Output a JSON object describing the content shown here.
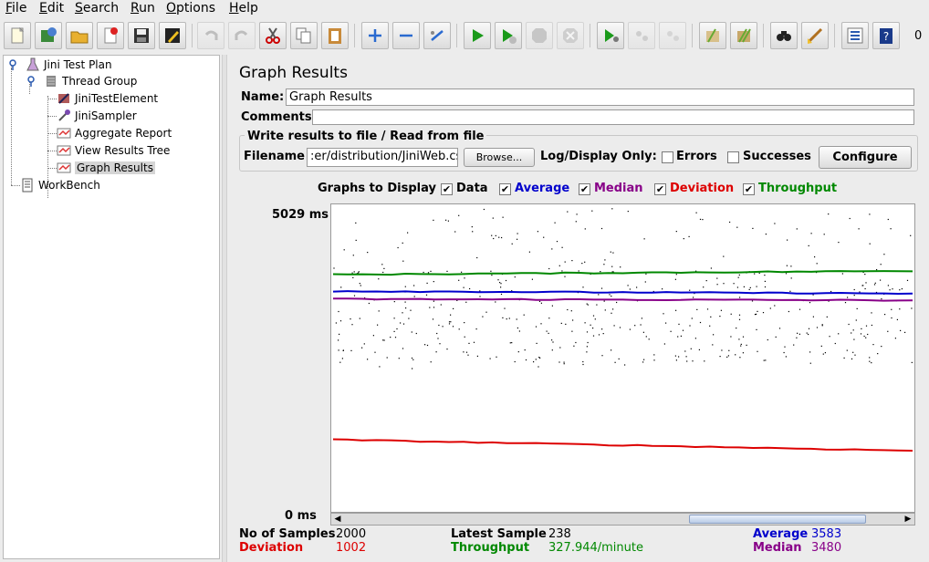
{
  "menu": {
    "items": [
      {
        "key": "F",
        "rest": "ile"
      },
      {
        "key": "E",
        "rest": "dit"
      },
      {
        "key": "S",
        "rest": "earch"
      },
      {
        "key": "R",
        "rest": "un"
      },
      {
        "key": "O",
        "rest": "ptions"
      },
      {
        "key": "H",
        "rest": "elp"
      }
    ]
  },
  "toolbar": {
    "count": "0"
  },
  "tree": {
    "test_plan": "Jini Test Plan",
    "thread_group": "Thread Group",
    "jini_test_element": "JiniTestElement",
    "jini_sampler": "JiniSampler",
    "aggregate_report": "Aggregate Report",
    "view_results_tree": "View Results Tree",
    "graph_results": "Graph Results",
    "workbench": "WorkBench"
  },
  "panel": {
    "title": "Graph Results",
    "name_label": "Name:",
    "name_value": "Graph Results",
    "comments_label": "Comments:",
    "comments_value": "",
    "write_group_title": "Write results to file / Read from file",
    "filename_label": "Filename",
    "filename_value": ":er/distribution/JiniWeb.csv",
    "browse_button": "Browse...",
    "log_display_label": "Log/Display Only:",
    "errors_label": "Errors",
    "successes_label": "Successes",
    "configure_button": "Configure",
    "graphs_to_display": "Graphs to Display",
    "graph_options": {
      "data": "Data",
      "average": "Average",
      "median": "Median",
      "deviation": "Deviation",
      "throughput": "Throughput"
    },
    "y_max_label": "5029 ms",
    "y_min_label": "0 ms"
  },
  "colors": {
    "average": "#0000cc",
    "median": "#880088",
    "deviation": "#dd0000",
    "throughput": "#008800",
    "data": "#000000"
  },
  "chart_data": {
    "type": "scatter",
    "ylim": [
      0,
      5029
    ],
    "y_unit": "ms",
    "series": [
      {
        "name": "Data",
        "values_note_points": 2000
      },
      {
        "name": "Average",
        "approx_ms": [
          3610,
          3570
        ]
      },
      {
        "name": "Median",
        "approx_ms": [
          3480,
          3460
        ]
      },
      {
        "name": "Deviation",
        "approx_ms": [
          1180,
          1000
        ]
      },
      {
        "name": "Throughput",
        "approx_ms": [
          3880,
          3940
        ]
      }
    ]
  },
  "stats": {
    "samples_label": "No of Samples",
    "samples_value": "2000",
    "latest_label": "Latest Sample",
    "latest_value": "238",
    "average_label": "Average",
    "average_value": "3583",
    "deviation_label": "Deviation",
    "deviation_value": "1002",
    "throughput_label": "Throughput",
    "throughput_value": "327.944/minute",
    "median_label": "Median",
    "median_value": "3480"
  }
}
